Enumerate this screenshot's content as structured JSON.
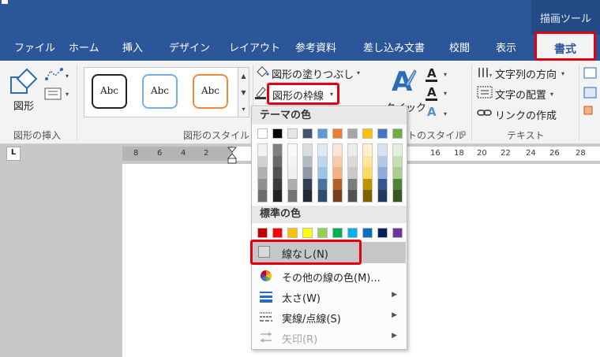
{
  "titlebar": {
    "context_label": "描画ツール"
  },
  "tabs": [
    "ファイル",
    "ホーム",
    "挿入",
    "デザイン",
    "レイアウト",
    "参考資料",
    "差し込み文書",
    "校閲",
    "表示"
  ],
  "active_tab": "書式",
  "ribbon": {
    "insert_shape_label": "図形",
    "insert_shape_group": "図形の挿入",
    "style_sample": "Abc",
    "shape_style_group": "図形のスタイル",
    "fill_label": "図形の塗りつぶし",
    "outline_label": "図形の枠線",
    "quick_label": "クイック",
    "wordart_group_partial": "トのスタイル",
    "text_direction": "文字列の方向",
    "text_align": "文字の配置",
    "create_link": "リンクの作成",
    "text_group": "テキスト",
    "a_glyph": "A"
  },
  "ruler": {
    "numbers": [
      "8",
      "6",
      "4",
      "2",
      "16",
      "18",
      "20",
      "22",
      "24",
      "26",
      "28"
    ]
  },
  "dropdown": {
    "theme_colors_header": "テーマの色",
    "standard_colors_header": "標準の色",
    "no_line": "線なし(N)",
    "more_colors": "その他の線の色(M)...",
    "weight": "太さ(W)",
    "dashes": "実線/点線(S)",
    "arrows": "矢印(R)"
  },
  "colors": {
    "theme": [
      "#ffffff",
      "#000000",
      "#e7e6e6",
      "#44546a",
      "#5b9bd5",
      "#ed7d31",
      "#a5a5a5",
      "#ffc000",
      "#4472c4",
      "#70ad47"
    ],
    "standard": [
      "#c00000",
      "#ff0000",
      "#ffc000",
      "#ffff00",
      "#92d050",
      "#00b050",
      "#00b0f0",
      "#0070c0",
      "#002060",
      "#7030a0"
    ],
    "accent": "#2b579a",
    "highlight": "#e3000f"
  }
}
